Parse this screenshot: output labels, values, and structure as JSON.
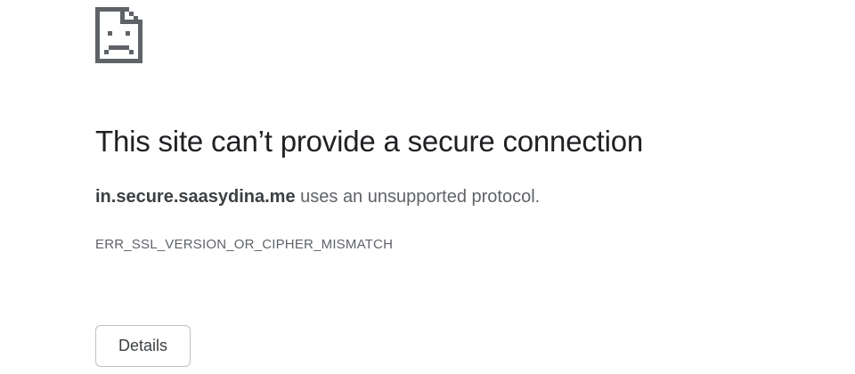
{
  "error_page": {
    "icon": "sad-document-icon",
    "title": "This site can’t provide a secure connection",
    "message": {
      "host": "in.secure.saasydina.me",
      "text": " uses an unsupported protocol."
    },
    "error_code": "ERR_SSL_VERSION_OR_CIPHER_MISMATCH",
    "details_button_label": "Details"
  }
}
